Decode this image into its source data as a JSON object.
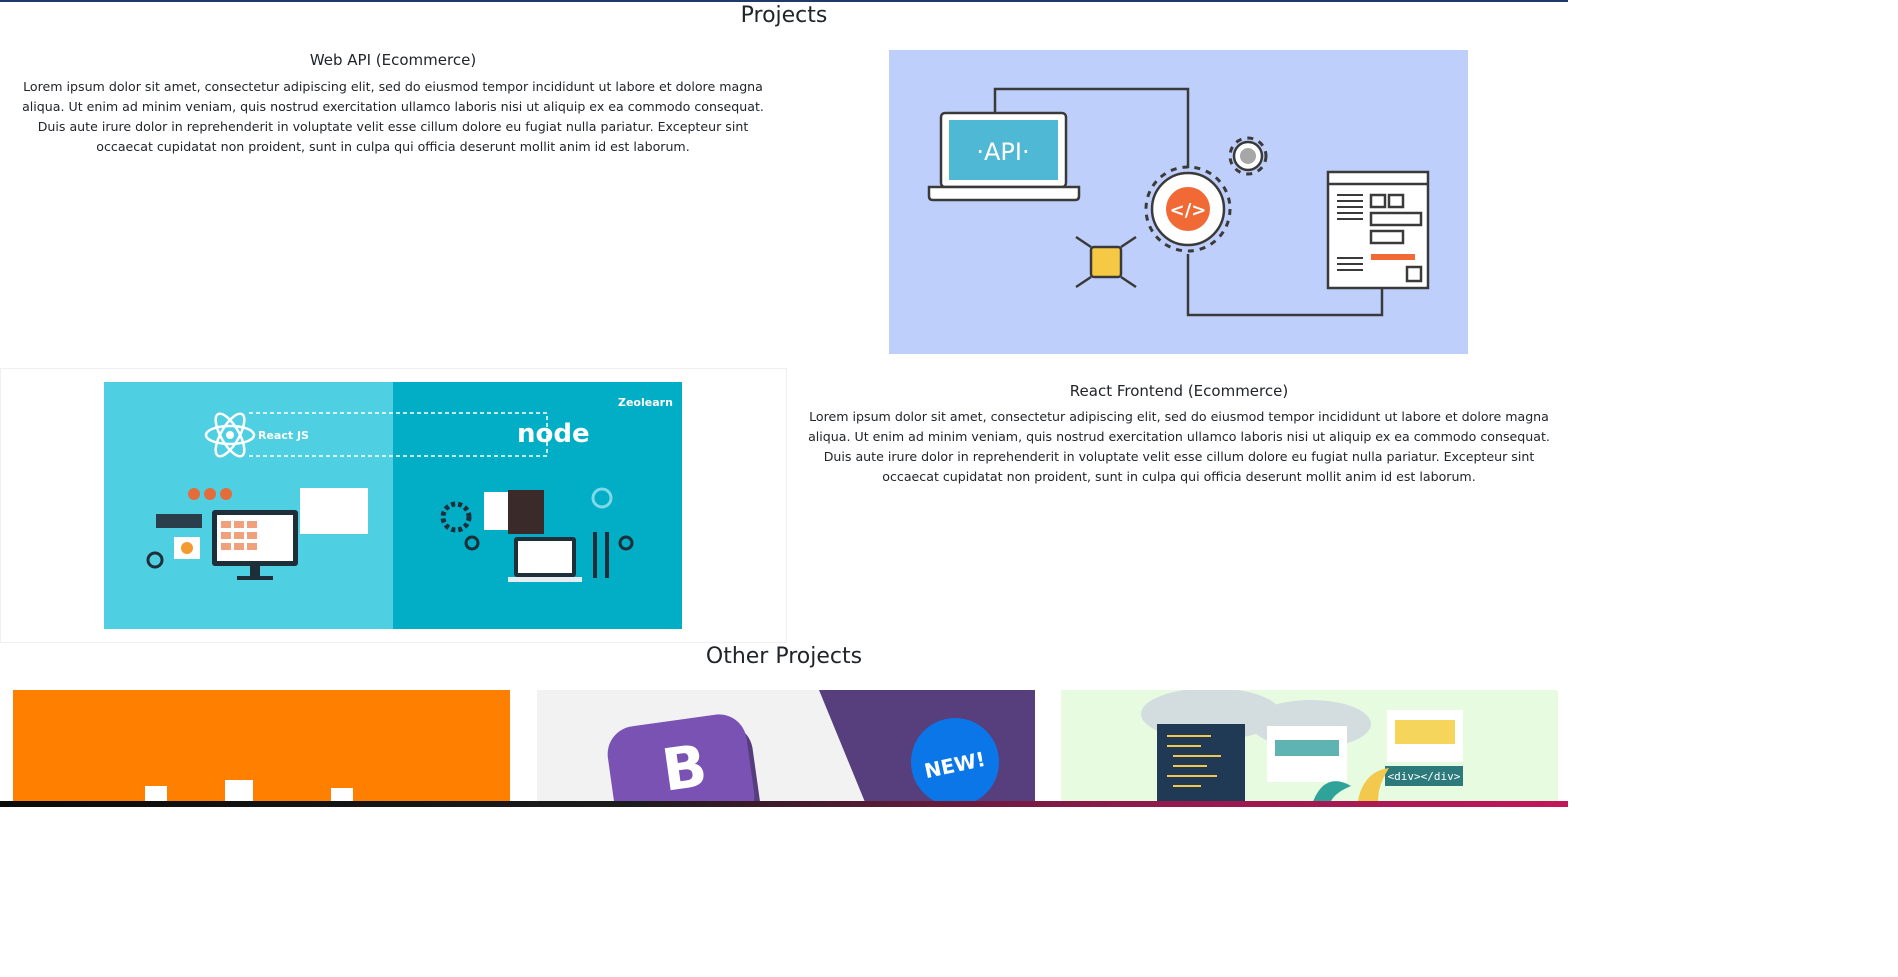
{
  "sections": {
    "projects_title": "Projects",
    "other_projects_title": "Other Projects"
  },
  "projects": [
    {
      "title": "Web API (Ecommerce)",
      "description": "Lorem ipsum dolor sit amet, consectetur adipiscing elit, sed do eiusmod tempor incididunt ut labore et dolore magna aliqua. Ut enim ad minim veniam, quis nostrud exercitation ullamco laboris nisi ut aliquip ex ea commodo consequat. Duis aute irure dolor in reprehenderit in voluptate velit esse cillum dolore eu fugiat nulla pariatur. Excepteur sint occaecat cupidatat non proident, sunt in culpa qui officia deserunt mollit anim id est laborum.",
      "image_text": "·API·"
    },
    {
      "title": "React Frontend (Ecommerce)",
      "description": "Lorem ipsum dolor sit amet, consectetur adipiscing elit, sed do eiusmod tempor incididunt ut labore et dolore magna aliqua. Ut enim ad minim veniam, quis nostrud exercitation ullamco laboris nisi ut aliquip ex ea commodo consequat. Duis aute irure dolor in reprehenderit in voluptate velit esse cillum dolore eu fugiat nulla pariatur. Excepteur sint occaecat cupidatat non proident, sunt in culpa qui officia deserunt mollit anim id est laborum.",
      "image_texts": {
        "react": "React JS",
        "node": "node",
        "brand": "Zeolearn"
      }
    }
  ],
  "other_projects": [
    {
      "image": "orange-thumbnail"
    },
    {
      "image": "bootstrap-thumbnail",
      "badge_text": "NEW!"
    },
    {
      "image": "web-dev-thumbnail",
      "tag_text": "<div></div>"
    }
  ],
  "colors": {
    "api_bg": "#bfcffb",
    "react_left": "#4fcfe2",
    "react_right": "#02adc6",
    "orange": "#ff7f00",
    "bootstrap_purple": "#573f7e"
  }
}
